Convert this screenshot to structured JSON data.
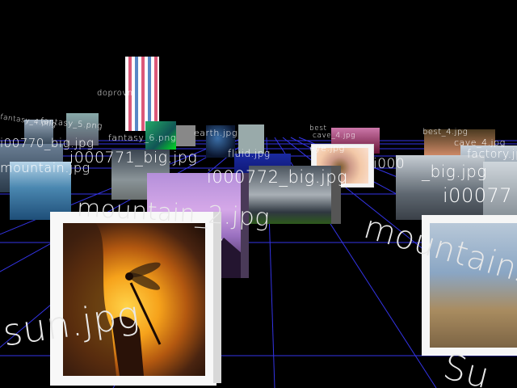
{
  "scene": {
    "background": "#000000",
    "grid_color": "#3a3aff"
  },
  "labels": {
    "sun": "sun.jpg",
    "mountain_2": "mountain_2.jpg",
    "mountains": "mountains",
    "su": "Su",
    "i000772_big": "i000772_big.jpg",
    "i000771_big": "i000771_big.jpg",
    "i000773": "i00077",
    "i000770_big": "i00770_big.jpg",
    "big_right": "_big.jpg",
    "i000_right": "i000",
    "mountain_left": "mountain.jpg",
    "fluid": "fluid.jpg",
    "earth": "earth.jpg",
    "fantasy_6": "fantasy_6.png",
    "fantasy_5": "fantasy_5.png",
    "fantasy_4": "fantasy_4.png",
    "doprovn": "doprovn",
    "eye": "eye.jpg",
    "cave_4": "cave_4.jpg",
    "cave_4b": "cave_4.jpg",
    "best_4": "best_4.jpg",
    "best": "best",
    "factory": "factory.jpg"
  },
  "colors": {
    "sun_glow": "#f6a21b",
    "mountain_purple": "#a07ad0",
    "storm_gray": "#7a8088",
    "sky_blue": "#6aa6d8"
  }
}
